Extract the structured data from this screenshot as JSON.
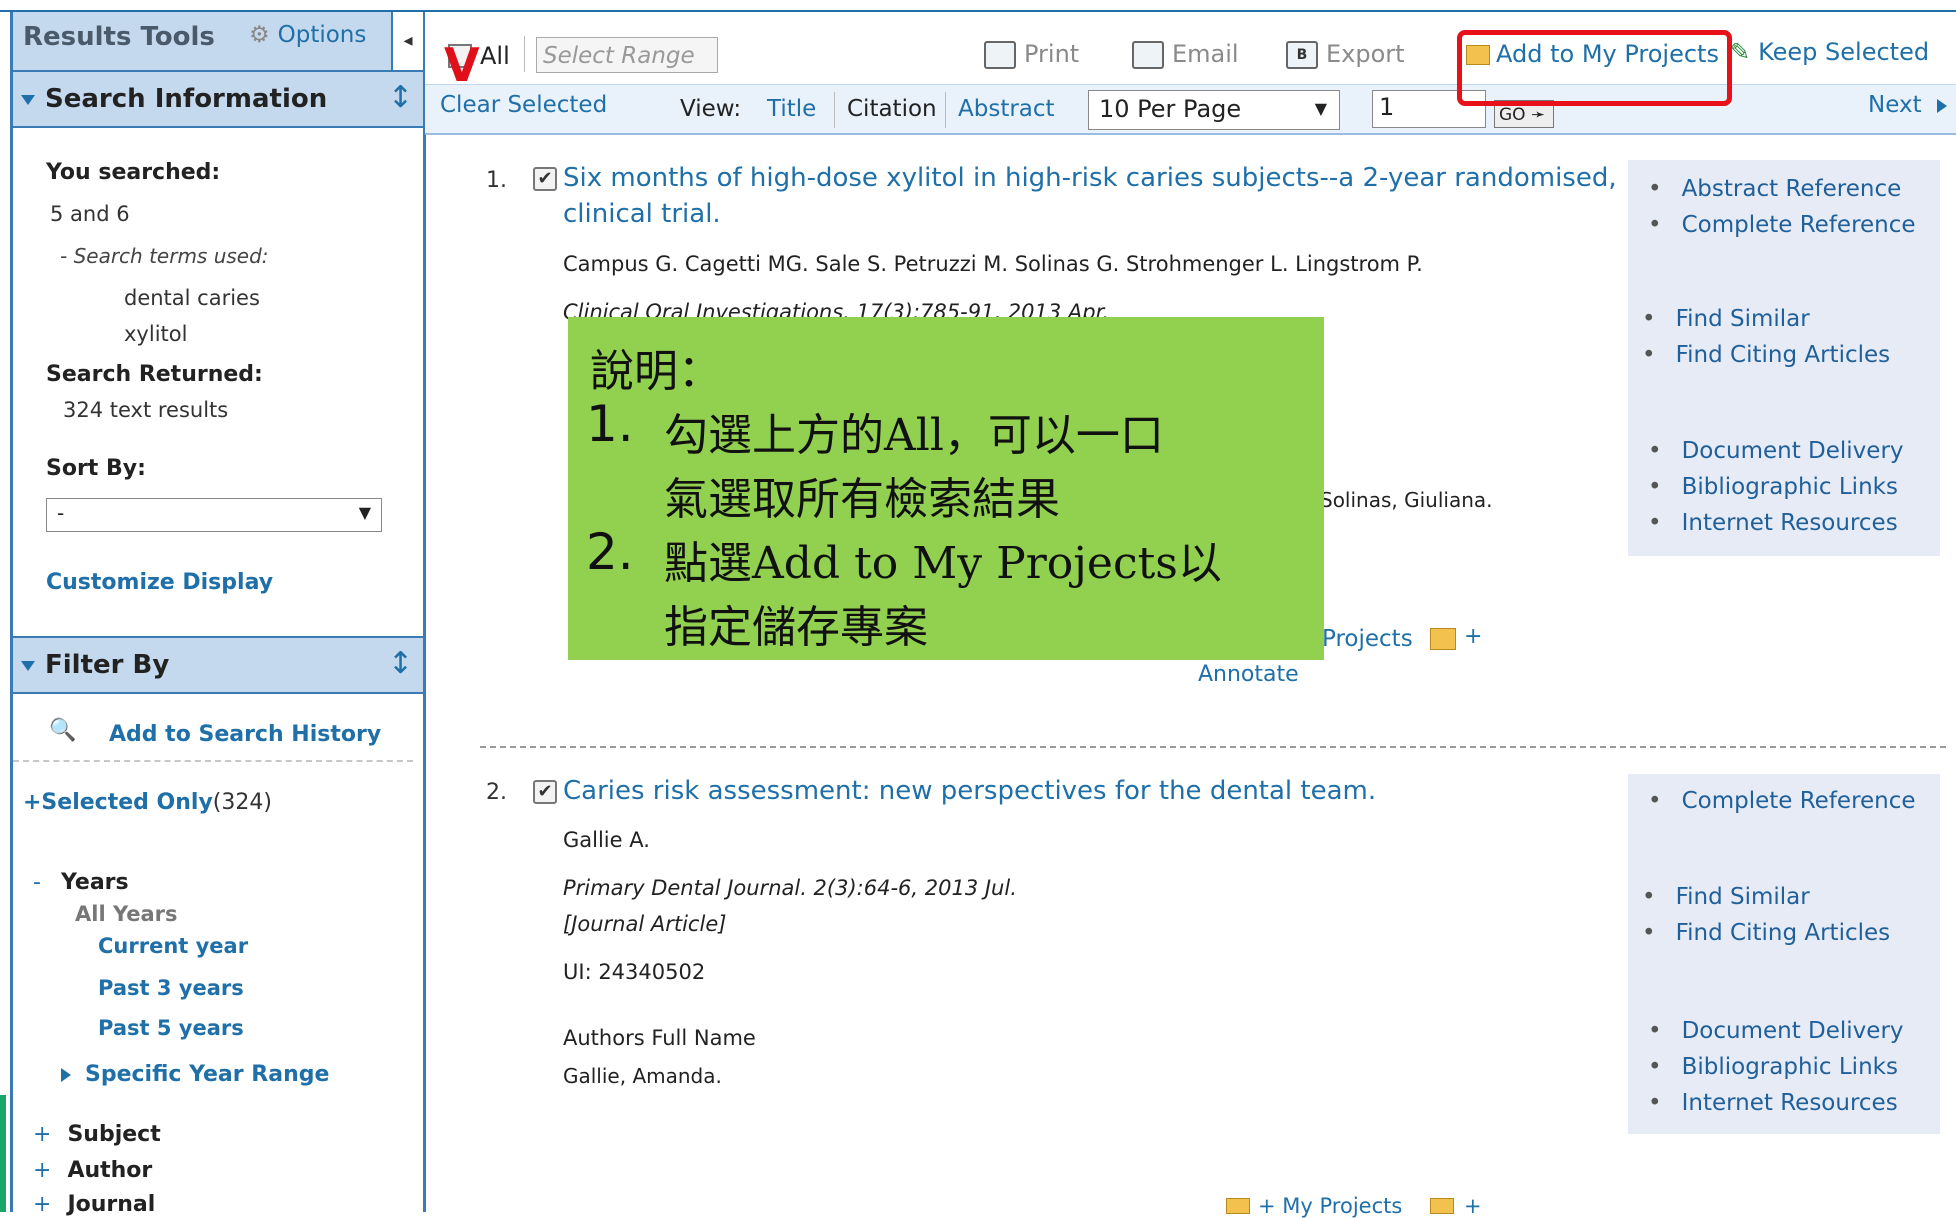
{
  "toolbar": {
    "all_label": "All",
    "select_range_placeholder": "Select Range",
    "print": "Print",
    "email": "Email",
    "export": "Export",
    "add_to_projects": "Add to My Projects",
    "keep_selected": "Keep Selected",
    "clear_selected": "Clear Selected",
    "view_label": "View:",
    "view_title": "Title",
    "view_citation": "Citation",
    "view_abstract": "Abstract",
    "per_page": "10 Per Page",
    "page_value": "1",
    "go": "GO",
    "next": "Next"
  },
  "left": {
    "header_title": "Results Tools",
    "options": "Options",
    "search_info": "Search Information",
    "you_searched": "You searched:",
    "query": "5 and 6",
    "terms_label": "- Search terms used:",
    "terms": [
      "dental caries",
      "xylitol"
    ],
    "returned_label": "Search Returned:",
    "returned_value": "324 text results",
    "sort_label": "Sort By:",
    "sort_value": "-",
    "customize": "Customize Display",
    "filter_by": "Filter By",
    "add_history": "Add to Search History",
    "selected_only": "+Selected Only",
    "selected_count": "(324)",
    "years_label": "Years",
    "years_items": [
      "All Years",
      "Current year",
      "Past 3 years",
      "Past 5 years"
    ],
    "specific_range": "Specific Year Range",
    "facets": [
      "Subject",
      "Author",
      "Journal"
    ]
  },
  "results": [
    {
      "num": "1.",
      "title_line1": "Six months of high-dose xylitol in high-risk caries subjects--a 2-year randomised,",
      "title_line2": "clinical trial.",
      "authors": "Campus G. Cagetti MG. Sale S. Petruzzi M. Solinas G. Strohmenger L. Lingstrom P.",
      "journal": "Clinical Oral Investigations. 17(3):785-91, 2013 Apr.",
      "partial_author": "Solinas, Giuliana.",
      "my_projects": "Projects",
      "annotate": "Annotate",
      "side_links": [
        "Abstract Reference",
        "Complete Reference",
        "Find Similar",
        "Find Citing Articles",
        "Document Delivery",
        "Bibliographic Links",
        "Internet Resources"
      ]
    },
    {
      "num": "2.",
      "title": "Caries risk assessment: new perspectives for the dental team.",
      "authors": "Gallie A.",
      "journal": "Primary Dental Journal. 2(3):64-6, 2013 Jul.",
      "type": "[Journal Article]",
      "ui": "UI: 24340502",
      "full_name_label": "Authors Full Name",
      "full_name": "Gallie, Amanda.",
      "my_projects": "My Projects",
      "side_links": [
        "Complete Reference",
        "Find Similar",
        "Find Citing Articles",
        "Document Delivery",
        "Bibliographic Links",
        "Internet Resources"
      ]
    }
  ],
  "note": {
    "heading": "說明：",
    "line1a": "1.",
    "line1b": "勾選上方的All，可以一口",
    "line1c": "氣選取所有檢索結果",
    "line2a": "2.",
    "line2b": "點選Add to My Projects以",
    "line2c": "指定儲存專案"
  },
  "colors": {
    "accent": "#1f6fa8",
    "note_bg": "#92d050",
    "highlight": "#e8111a",
    "panel_head": "#c4d9ee",
    "side_bg": "#e6ebf5"
  }
}
